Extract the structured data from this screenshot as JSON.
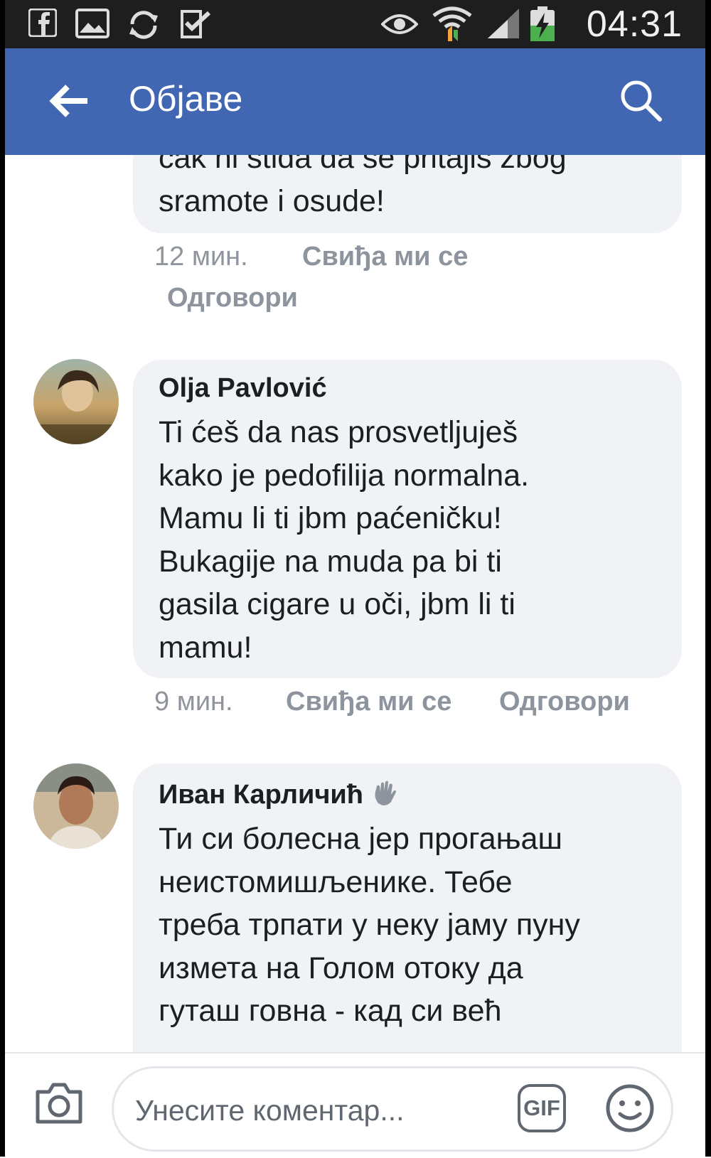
{
  "status_bar": {
    "time": "04:31"
  },
  "app_bar": {
    "title": "Објаве"
  },
  "comments": [
    {
      "text_lines": [
        "cak ni stida da se pritajis zbog",
        "sramote i osude!"
      ],
      "time": "12 мин.",
      "like_label": "Свиђа ми се",
      "reply_label": "Одговори"
    },
    {
      "author": "Olja Pavlović",
      "text_lines": [
        "Ti ćeš da nas prosvetljuješ",
        "kako je pedofilija normalna.",
        "Mamu li ti jbm paćeničku!",
        "Bukagije na muda pa bi ti",
        "gasila cigare u oči, jbm li ti",
        "mamu!"
      ],
      "time": "9 мин.",
      "like_label": "Свиђа ми се",
      "reply_label": "Одговори"
    },
    {
      "author": "Иван Карличић",
      "author_badge_icon": "waving-hand-icon",
      "text_lines": [
        "Ти си болесна јер прогањаш",
        "неистомишљенике. Тебе",
        "треба трпати у неку јаму пуну",
        "измета на Голом отоку да",
        "гуташ говна - кад си већ"
      ]
    }
  ],
  "composer": {
    "placeholder": "Унесите коментар...",
    "gif_label": "GIF",
    "icons": [
      "camera-icon",
      "emoji-icon"
    ]
  },
  "colors": {
    "app_bar": "#4267b2",
    "bubble": "#f0f2f5",
    "meta_text": "#8d949e",
    "status_bar": "#1e1e1e"
  }
}
